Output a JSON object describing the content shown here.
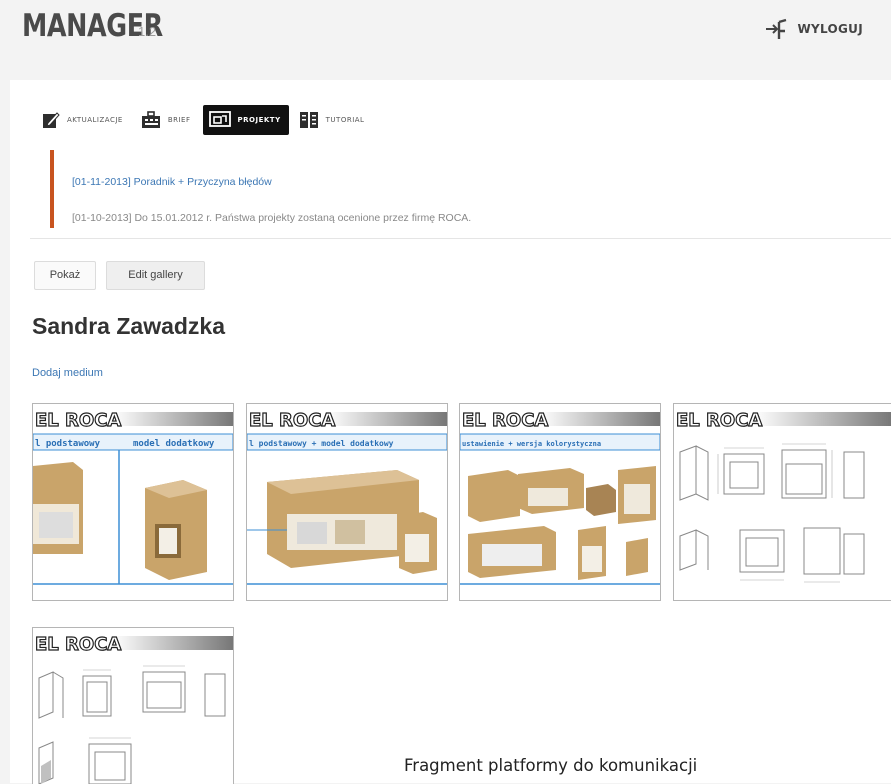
{
  "app": {
    "title": "MANAGER",
    "version": "1.2",
    "logout_label": "WYLOGUJ"
  },
  "tabs": [
    {
      "label": "AKTUALIZACJE",
      "icon": "pencil-icon",
      "active": false
    },
    {
      "label": "BRIEF",
      "icon": "briefcase-icon",
      "active": false
    },
    {
      "label": "PROJEKTY",
      "icon": "monitor-icon",
      "active": true
    },
    {
      "label": "TUTORIAL",
      "icon": "book-icon",
      "active": false
    }
  ],
  "news": [
    "[01-11-2013] Poradnik + Przyczyna błędów",
    "[01-10-2013] Do 15.01.2012 r. Państwa projekty zostaną ocenione przez firmę ROCA."
  ],
  "buttons": {
    "show": "Pokaż",
    "edit_gallery": "Edit gallery"
  },
  "user_name": "Sandra Zawadzka",
  "add_media": "Dodaj medium",
  "gallery": [
    {
      "brand": "EL ROCA",
      "headers": [
        "l podstawowy",
        "model dodatkowy"
      ],
      "kind": "render"
    },
    {
      "brand": "EL ROCA",
      "headers": [
        "l podstawowy + model dodatkowy"
      ],
      "kind": "render"
    },
    {
      "brand": "EL ROCA",
      "headers": [
        "ustawienie + wersja kolorystyczna"
      ],
      "kind": "render"
    },
    {
      "brand": "EL ROCA",
      "headers": [],
      "kind": "technical-drawing"
    },
    {
      "brand": "EL ROCA",
      "headers": [],
      "kind": "technical-drawing"
    }
  ],
  "caption": "Fragment platformy do komunikacji",
  "colors": {
    "accent_bar": "#c8541f",
    "link": "#3c77b4",
    "header_blue": "#3d8fd6",
    "wood": "#c9a46a"
  }
}
